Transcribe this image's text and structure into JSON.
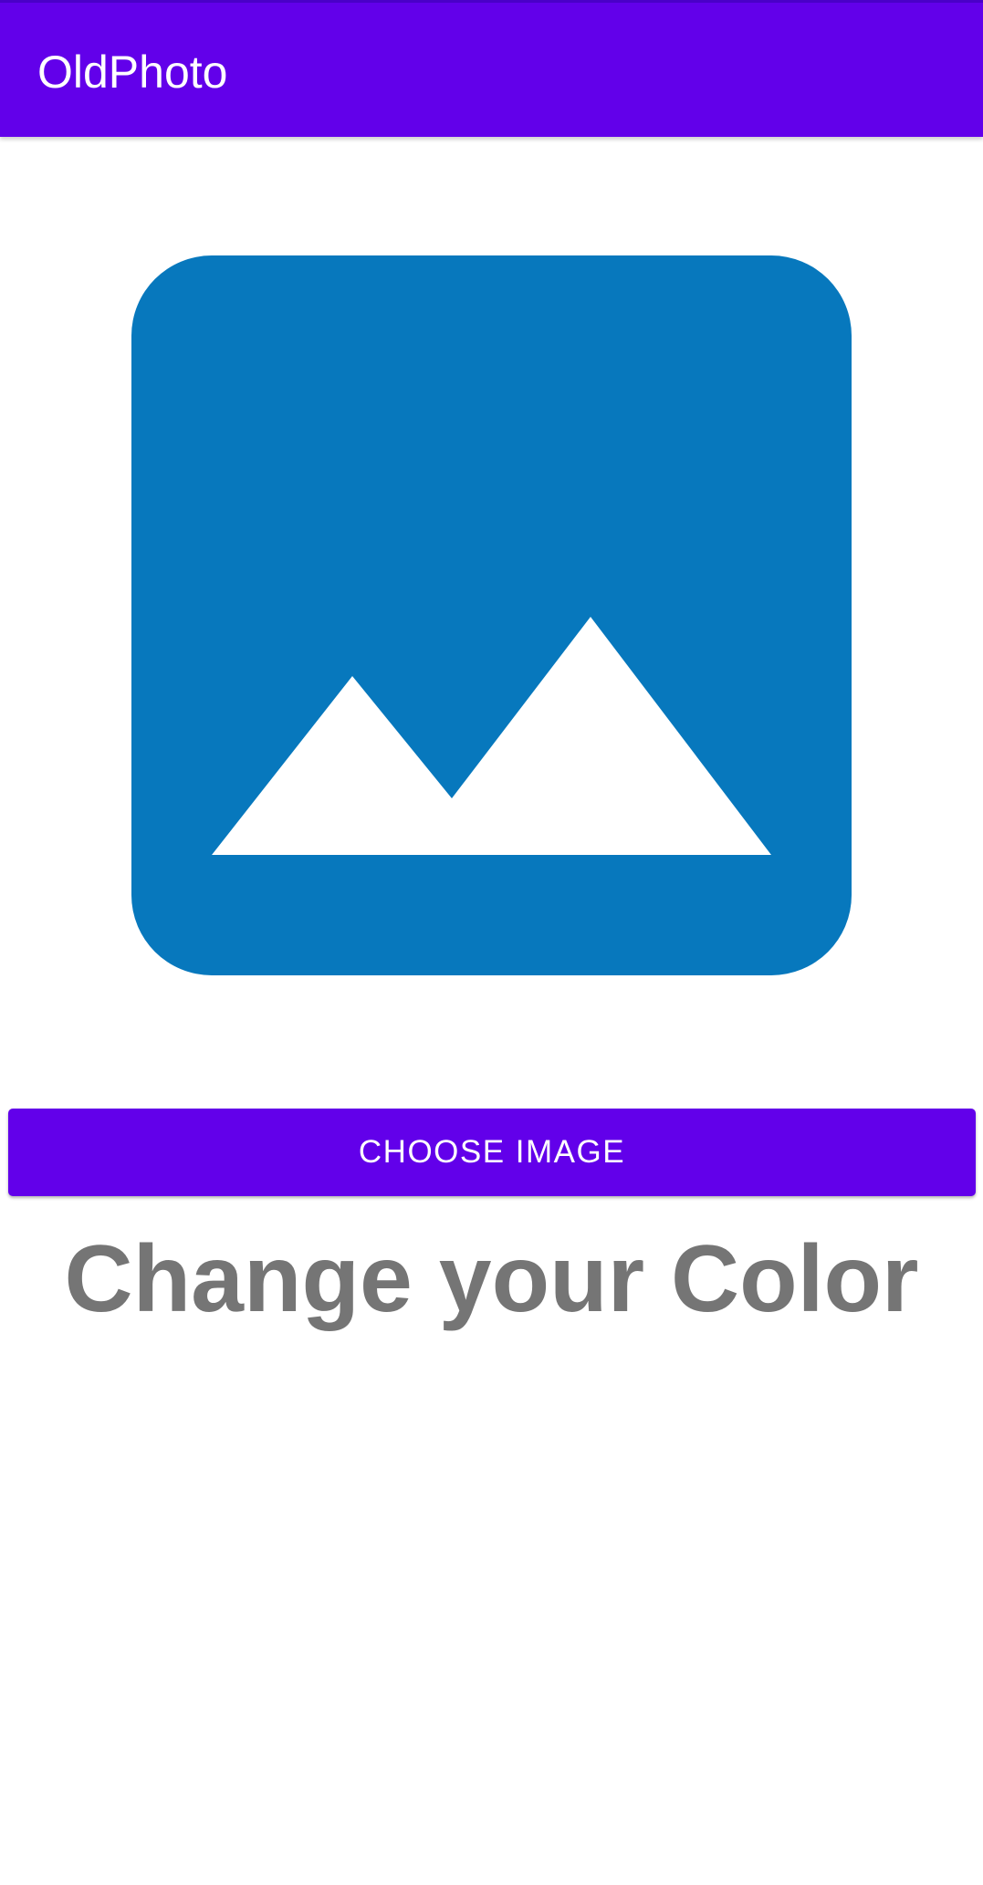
{
  "app_bar": {
    "title": "OldPhoto",
    "color": "#6200ea"
  },
  "image_placeholder": {
    "icon": "image-icon",
    "color": "#0778bd"
  },
  "choose_button": {
    "label": "CHOOSE IMAGE",
    "color": "#6200ea"
  },
  "headline": {
    "text": "Change your Color",
    "color": "#757575"
  }
}
